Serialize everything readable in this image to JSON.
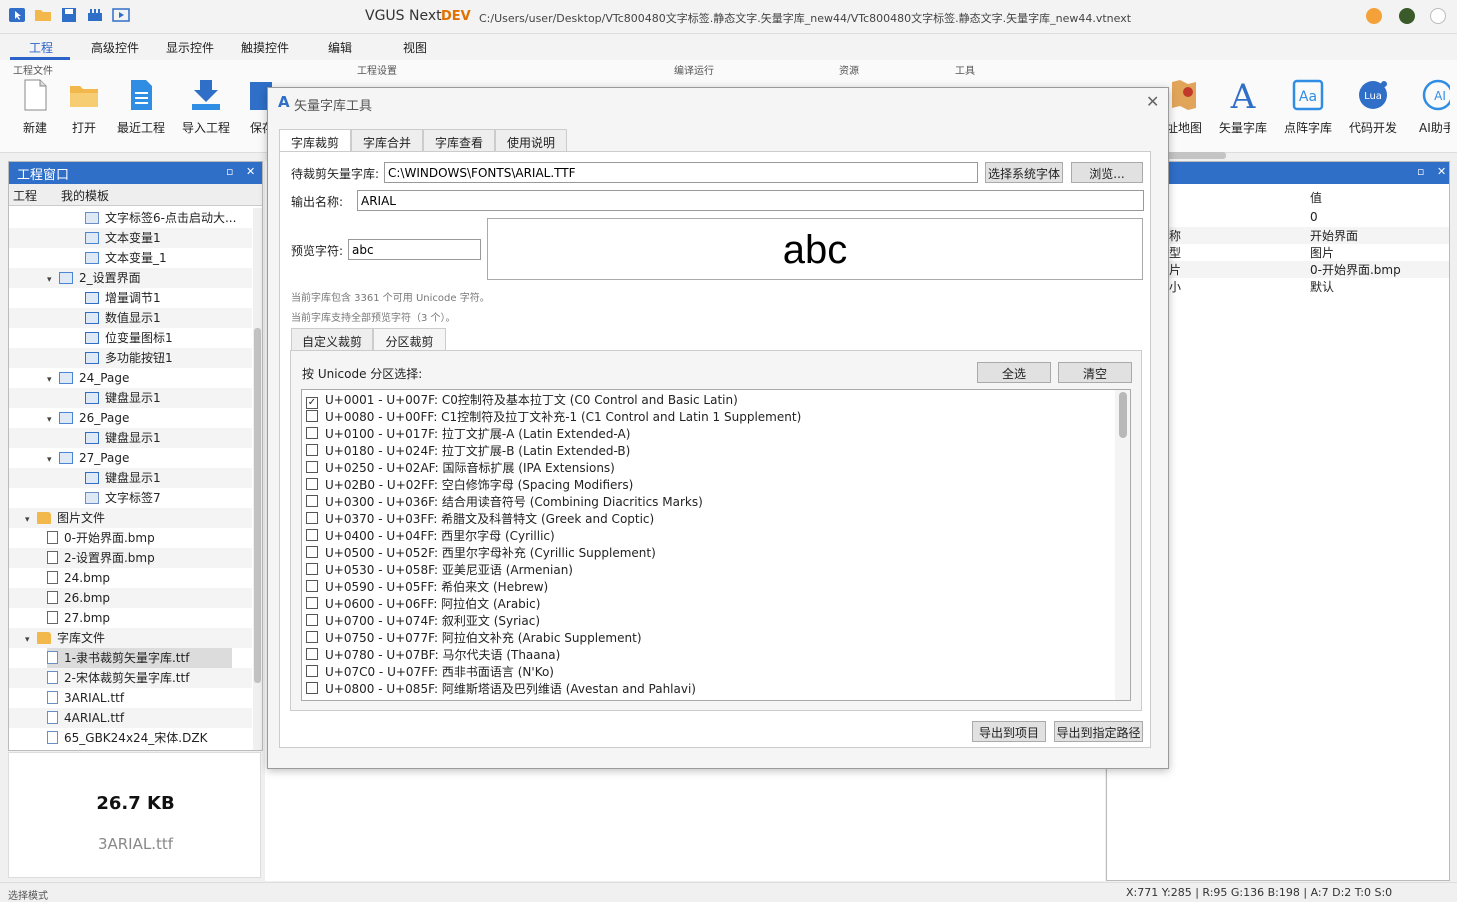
{
  "titlebar": {
    "app_name": "VGUS Next",
    "dev_badge": "DEV",
    "file_path": "C:/Users/user/Desktop/VTc800480文字标签.静态文字.矢量字库_new44/VTc800480文字标签.静态文字.矢量字库_new44.vtnext"
  },
  "ribbon": {
    "tabs": [
      "工程",
      "高级控件",
      "显示控件",
      "触摸控件",
      "编辑",
      "视图"
    ],
    "groups": {
      "project_file": "工程文件",
      "project_settings": "工程设置",
      "compile_run": "编译运行",
      "resources": "资源",
      "tools": "工具"
    },
    "buttons": {
      "new": "新建",
      "open": "打开",
      "recent": "最近工程",
      "import": "导入工程",
      "save": "保存",
      "address_map": "址地图",
      "vector_font": "矢量字库",
      "dot_font": "点阵字库",
      "code_dev": "代码开发",
      "ai_assistant": "AI助手"
    }
  },
  "left_panel": {
    "title": "工程窗口",
    "tabs": [
      "工程",
      "我的模板"
    ],
    "tree": [
      {
        "label": "文字标签6-点击启动大...",
        "icon": "text-icon"
      },
      {
        "label": "文本变量1",
        "icon": "textvar-icon"
      },
      {
        "label": "文本变量_1",
        "icon": "textvar-icon"
      },
      {
        "label": "2_设置界面",
        "icon": "page-icon"
      },
      {
        "label": "增量调节1",
        "icon": "increment-icon"
      },
      {
        "label": "数值显示1",
        "icon": "number-icon"
      },
      {
        "label": "位变量图标1",
        "icon": "bit-icon"
      },
      {
        "label": "多功能按钮1",
        "icon": "button-icon"
      },
      {
        "label": "24_Page",
        "icon": "page-icon"
      },
      {
        "label": "键盘显示1",
        "icon": "keyboard-icon"
      },
      {
        "label": "26_Page",
        "icon": "page-icon"
      },
      {
        "label": "键盘显示1",
        "icon": "keyboard-icon"
      },
      {
        "label": "27_Page",
        "icon": "page-icon"
      },
      {
        "label": "键盘显示1",
        "icon": "keyboard-icon"
      },
      {
        "label": "文字标签7",
        "icon": "text-icon"
      },
      {
        "label": "图片文件",
        "icon": "folder-icon"
      },
      {
        "label": "0-开始界面.bmp",
        "icon": "image-file-icon"
      },
      {
        "label": "2-设置界面.bmp",
        "icon": "image-file-icon"
      },
      {
        "label": "24.bmp",
        "icon": "image-file-icon"
      },
      {
        "label": "26.bmp",
        "icon": "image-file-icon"
      },
      {
        "label": "27.bmp",
        "icon": "image-file-icon"
      },
      {
        "label": "字库文件",
        "icon": "folder-icon"
      },
      {
        "label": "1-隶书裁剪矢量字库.ttf",
        "icon": "font-file-icon"
      },
      {
        "label": "2-宋体裁剪矢量字库.ttf",
        "icon": "font-file-icon"
      },
      {
        "label": "3ARIAL.ttf",
        "icon": "font-file-icon"
      },
      {
        "label": "4ARIAL.ttf",
        "icon": "font-file-icon"
      },
      {
        "label": "65_GBK24x24_宋体.DZK",
        "icon": "font-file-icon"
      }
    ]
  },
  "file_info": {
    "size": "26.7 KB",
    "name": "3ARIAL.ttf"
  },
  "right_panel": {
    "value_header": "值",
    "rows": [
      {
        "key": "",
        "value": "0"
      },
      {
        "key": "称",
        "value": "开始界面"
      },
      {
        "key": "型",
        "value": "图片"
      },
      {
        "key": "片",
        "value": "0-开始界面.bmp"
      },
      {
        "key": "小",
        "value": "默认"
      }
    ]
  },
  "statusbar": {
    "mode": "选择模式",
    "coords": "X:771  Y:285  |  R:95 G:136 B:198  |  A:7  D:2  T:0  S:0"
  },
  "dialog": {
    "title": "矢量字库工具",
    "tabs": [
      "字库裁剪",
      "字库合并",
      "字库查看",
      "使用说明"
    ],
    "source_label": "待裁剪矢量字库:",
    "source_value": "C:\\WINDOWS\\FONTS\\ARIAL.TTF",
    "select_system_font": "选择系统字体",
    "browse": "浏览...",
    "output_label": "输出名称:",
    "output_value": "ARIAL",
    "preview_label": "预览字符:",
    "preview_value": "abc",
    "preview_render": "abc",
    "hint_count": "当前字库包含 3361 个可用 Unicode 字符。",
    "hint_support": "当前字库支持全部预览字符（3 个）。",
    "subtabs": [
      "自定义裁剪",
      "分区裁剪"
    ],
    "unicode_label": "按 Unicode 分区选择:",
    "select_all": "全选",
    "clear": "清空",
    "ranges": [
      {
        "text": "U+0001 - U+007F:  C0控制符及基本拉丁文 (C0 Control and Basic Latin)",
        "checked": true
      },
      {
        "text": "U+0080 - U+00FF:  C1控制符及拉丁文补充-1 (C1 Control and Latin 1 Supplement)",
        "checked": false
      },
      {
        "text": "U+0100 - U+017F:  拉丁文扩展-A (Latin Extended-A)",
        "checked": false
      },
      {
        "text": "U+0180 - U+024F:  拉丁文扩展-B (Latin Extended-B)",
        "checked": false
      },
      {
        "text": "U+0250 - U+02AF:  国际音标扩展 (IPA Extensions)",
        "checked": false
      },
      {
        "text": "U+02B0 - U+02FF:  空白修饰字母 (Spacing Modifiers)",
        "checked": false
      },
      {
        "text": "U+0300 - U+036F:  结合用读音符号 (Combining Diacritics Marks)",
        "checked": false
      },
      {
        "text": "U+0370 - U+03FF:  希腊文及科普特文 (Greek and Coptic)",
        "checked": false
      },
      {
        "text": "U+0400 - U+04FF:  西里尔字母 (Cyrillic)",
        "checked": false
      },
      {
        "text": "U+0500 - U+052F:  西里尔字母补充 (Cyrillic Supplement)",
        "checked": false
      },
      {
        "text": "U+0530 - U+058F:  亚美尼亚语 (Armenian)",
        "checked": false
      },
      {
        "text": "U+0590 - U+05FF:  希伯来文 (Hebrew)",
        "checked": false
      },
      {
        "text": "U+0600 - U+06FF:  阿拉伯文 (Arabic)",
        "checked": false
      },
      {
        "text": "U+0700 - U+074F:  叙利亚文 (Syriac)",
        "checked": false
      },
      {
        "text": "U+0750 - U+077F:  阿拉伯文补充 (Arabic Supplement)",
        "checked": false
      },
      {
        "text": "U+0780 - U+07BF:  马尔代夫语 (Thaana)",
        "checked": false
      },
      {
        "text": "U+07C0 - U+07FF:  西非书面语言 (N'Ko)",
        "checked": false
      },
      {
        "text": "U+0800 - U+085F:  阿维斯塔语及巴列维语 (Avestan and Pahlavi)",
        "checked": false
      }
    ],
    "export_project": "导出到项目",
    "export_path": "导出到指定路径"
  },
  "colors": {
    "accent": "#2f6fc8",
    "window_min": "#f5a13a",
    "window_max": "#3a5a2a"
  }
}
